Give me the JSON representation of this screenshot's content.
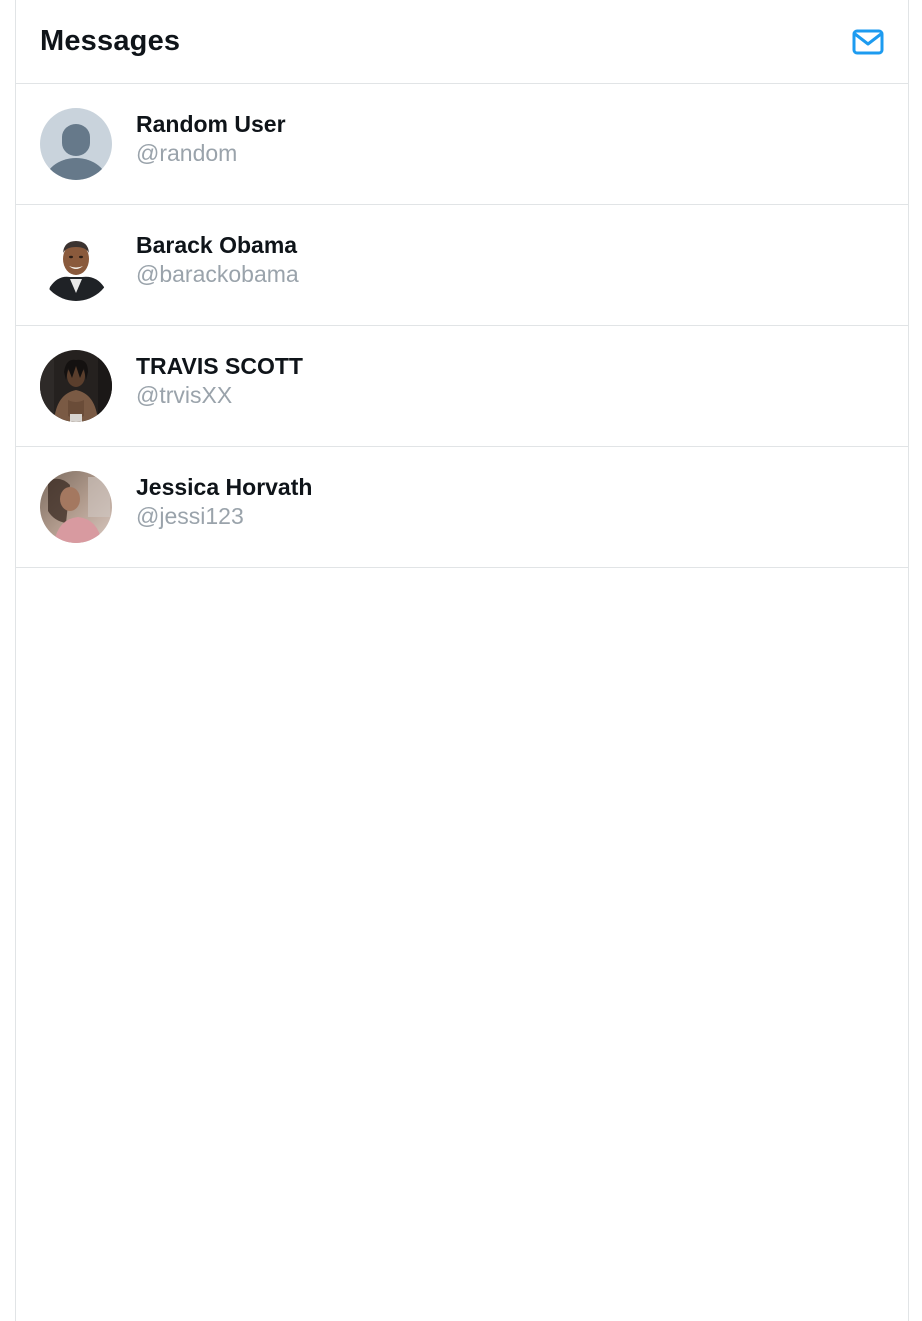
{
  "header": {
    "title": "Messages",
    "new_message_icon": "envelope-icon",
    "accent_color": "#1d9bf0"
  },
  "conversations": [
    {
      "name": "Random User",
      "handle": "@random",
      "avatar": "default-avatar-icon"
    },
    {
      "name": "Barack Obama",
      "handle": "@barackobama",
      "avatar": "photo-avatar"
    },
    {
      "name": "TRAVIS SCOTT",
      "handle": "@trvisXX",
      "avatar": "photo-avatar"
    },
    {
      "name": "Jessica Horvath",
      "handle": "@jessi123",
      "avatar": "photo-avatar"
    }
  ]
}
